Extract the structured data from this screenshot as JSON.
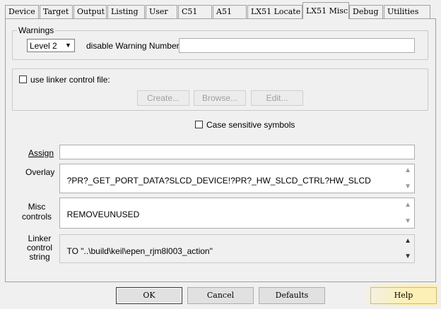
{
  "tabs": [
    "Device",
    "Target",
    "Output",
    "Listing",
    "User",
    "C51",
    "A51",
    "LX51 Locate",
    "LX51 Misc",
    "Debug",
    "Utilities"
  ],
  "active_tab": "LX51 Misc",
  "warnings": {
    "legend": "Warnings",
    "level_value": "Level 2",
    "disable_label": "disable Warning Numbers:",
    "disable_value": ""
  },
  "linker_control": {
    "checkbox_label": "use linker control file:",
    "checked": false,
    "create_label": "Create...",
    "browse_label": "Browse...",
    "edit_label": "Edit..."
  },
  "case_sensitive": {
    "label": "Case sensitive symbols",
    "checked": false
  },
  "assign": {
    "label": "Assign",
    "value": ""
  },
  "overlay": {
    "label": "Overlay",
    "value": "?PR?_GET_PORT_DATA?SLCD_DEVICE!?PR?_HW_SLCD_CTRL?HW_SLCD"
  },
  "misc": {
    "label_line1": "Misc",
    "label_line2": "controls",
    "value": "REMOVEUNUSED"
  },
  "linker_string": {
    "label_line1": "Linker",
    "label_line2": "control",
    "label_line3": "string",
    "value": "TO \"..\\build\\keil\\epen_rjm8l003_action\""
  },
  "footer": {
    "ok": "OK",
    "cancel": "Cancel",
    "defaults": "Defaults",
    "help": "Help"
  }
}
